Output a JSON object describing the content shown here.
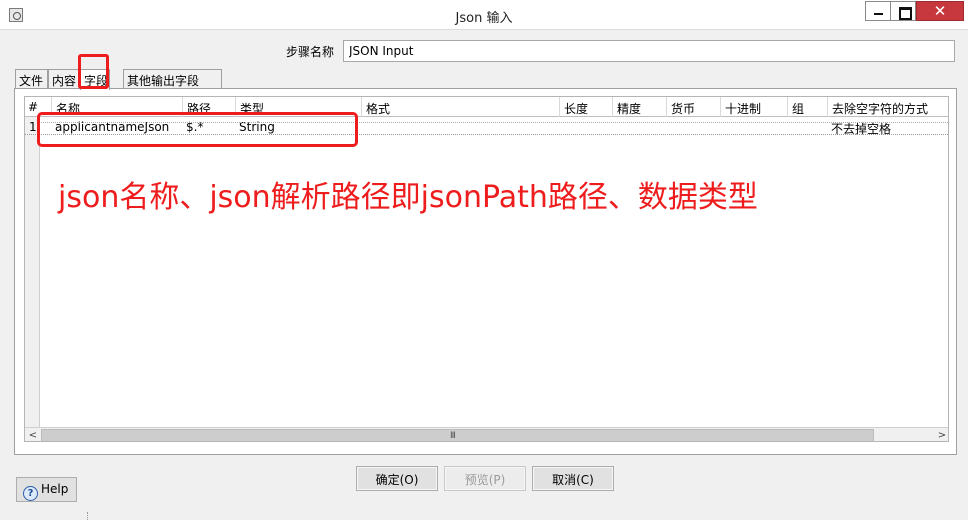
{
  "window": {
    "title": "Json 输入"
  },
  "step": {
    "label": "步骤名称",
    "value": "JSON Input"
  },
  "tabs": [
    {
      "label": "文件"
    },
    {
      "label": "内容"
    },
    {
      "label": "字段"
    },
    {
      "label": "其他输出字段"
    }
  ],
  "active_tab": "字段",
  "table": {
    "columns": [
      "#",
      "名称",
      "路径",
      "类型",
      "格式",
      "长度",
      "精度",
      "货币",
      "十进制",
      "组",
      "去除空字符的方式"
    ],
    "rows": [
      {
        "num": "1",
        "name": "applicantnameJson",
        "path": "$.*",
        "type": "String",
        "format": "",
        "length": "",
        "precision": "",
        "currency": "",
        "decimal": "",
        "group": "",
        "trim": "不去掉空格"
      }
    ]
  },
  "annotation": {
    "text": "json名称、json解析路径即jsonPath路径、数据类型",
    "color": "#ee1c1c"
  },
  "scrollbar": {
    "grip": "III"
  },
  "buttons": {
    "ok": "确定(O)",
    "preview": "预览(P)",
    "cancel": "取消(C)",
    "help": "Help"
  },
  "icons": {
    "app": "app-icon",
    "minimize": "minimize-icon",
    "maximize": "maximize-icon",
    "close": "close-icon",
    "help": "help-icon"
  }
}
